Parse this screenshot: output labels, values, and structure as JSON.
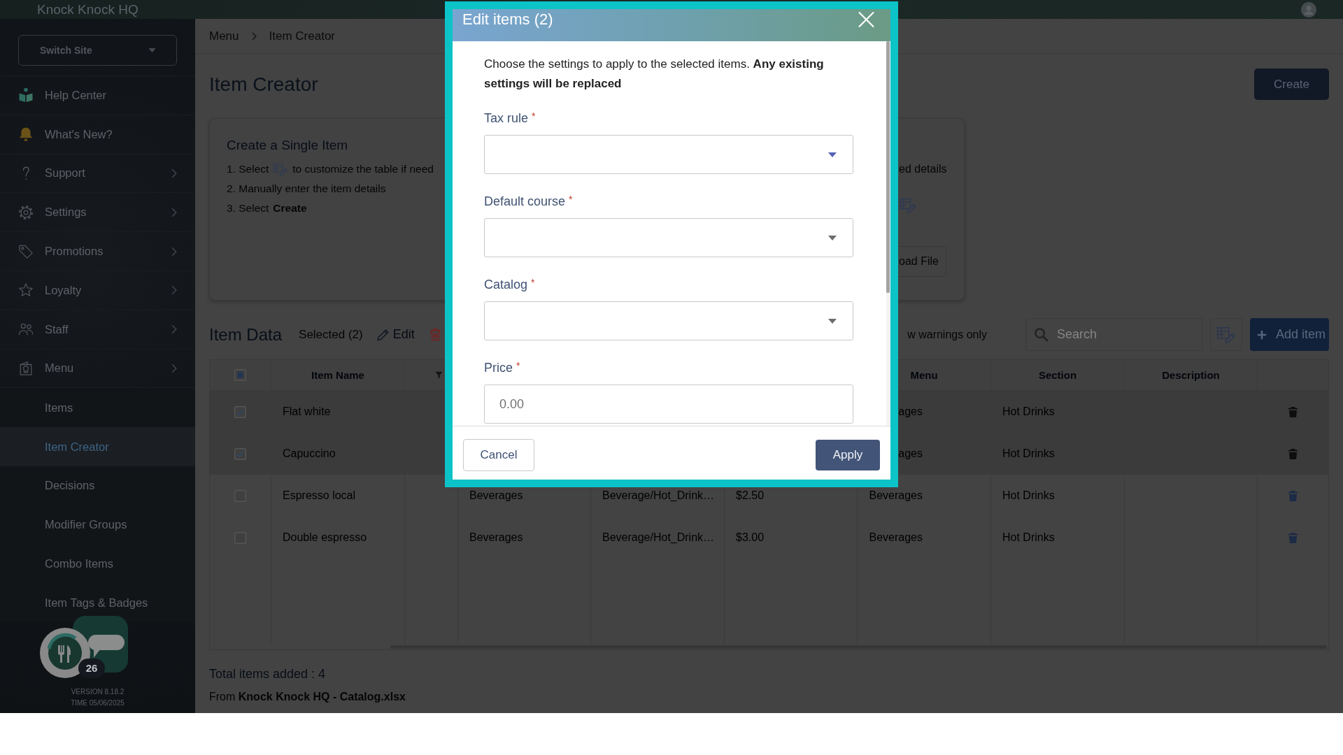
{
  "top_bar": {
    "title": "Knock Knock HQ"
  },
  "sidebar": {
    "site_switcher": {
      "label": "Switch Site"
    },
    "items": [
      {
        "label": "Help Center",
        "submenu": false,
        "selected": false
      },
      {
        "label": "What's New?",
        "submenu": false,
        "selected": false
      },
      {
        "label": "Support",
        "submenu": true,
        "selected": false
      },
      {
        "label": "Settings",
        "submenu": true,
        "selected": false
      },
      {
        "label": "Promotions",
        "submenu": true,
        "selected": false
      },
      {
        "label": "Loyalty",
        "submenu": true,
        "selected": false
      },
      {
        "label": "Staff",
        "submenu": true,
        "selected": false
      },
      {
        "label": "Menu",
        "submenu": true,
        "selected": false,
        "children": [
          {
            "label": "Items",
            "selected": false
          },
          {
            "label": "Item Creator",
            "selected": true
          },
          {
            "label": "Decisions",
            "selected": false
          },
          {
            "label": "Modifier Groups",
            "selected": false
          },
          {
            "label": "Combo Items",
            "selected": false
          },
          {
            "label": "Item Tags & Badges",
            "selected": false
          }
        ]
      }
    ],
    "notification_count": "26",
    "version": "VERSION 8.18.2",
    "time": "TIME 05/06/2025"
  },
  "breadcrumbs": [
    "Menu",
    "Item Creator"
  ],
  "page_title": "Item Creator",
  "create_button": "Create",
  "instructions_card": {
    "title": "Create a Single Item",
    "steps": [
      {
        "kind": "with_icon",
        "before": "1. Select",
        "after": "to customize the table if need"
      },
      {
        "kind": "text",
        "text": "2. Manually enter the item details"
      },
      {
        "kind": "text",
        "text": "3. Select **Create**"
      }
    ],
    "file_section": {
      "text": "ed details",
      "button": "oad File"
    }
  },
  "item_data": {
    "title": "Item Data",
    "selected_count": "Selected (2)",
    "edit": "Edit",
    "warnings_filter": "w warnings only",
    "search": {
      "placeholder": "Search"
    },
    "add_button": "Add item"
  },
  "table": {
    "header_checkbox": {
      "indeterminate": true
    },
    "columns": [
      "Item Name",
      "Menu",
      "Section",
      "Description"
    ],
    "rows": [
      {
        "selected": true,
        "checked": true,
        "item_name": "Flat white",
        "menu": "ages",
        "section": "Hot Drinks"
      },
      {
        "selected": true,
        "checked": true,
        "item_name": "Capuccino",
        "menu": "ages",
        "section": "Hot Drinks"
      },
      {
        "selected": false,
        "checked": false,
        "item_name": "Espresso local",
        "column_4": "Beverages",
        "column_5": "Beverage/Hot_Drink…",
        "column_6": "$2.50",
        "menu": "Beverages",
        "section": "Hot Drinks"
      },
      {
        "selected": false,
        "checked": false,
        "item_name": "Double espresso",
        "column_4": "Beverages",
        "column_5": "Beverage/Hot_Drink…",
        "column_6": "$3.00",
        "menu": "Beverages",
        "section": "Hot Drinks"
      }
    ]
  },
  "summary": {
    "total": "Total items added : 4",
    "source": "From **Knock Knock HQ - Catalog.xlsx**"
  },
  "modal": {
    "title": "Edit items (2)",
    "description": "Choose the settings to apply to the selected items. **Any existing settings will be replaced**",
    "fields": [
      {
        "kind": "select",
        "label": "Tax rule",
        "required_mark": "*",
        "focused": true
      },
      {
        "kind": "select",
        "label": "Default course",
        "required_mark": "*",
        "focused": false
      },
      {
        "kind": "select",
        "label": "Catalog",
        "required_mark": "*",
        "focused": false
      },
      {
        "kind": "input",
        "label": "Price",
        "required_mark": "*",
        "placeholder": "0.00"
      }
    ],
    "buttons": [
      {
        "kind": "secondary",
        "label": "Cancel"
      },
      {
        "kind": "primary",
        "label": "Apply"
      }
    ]
  }
}
